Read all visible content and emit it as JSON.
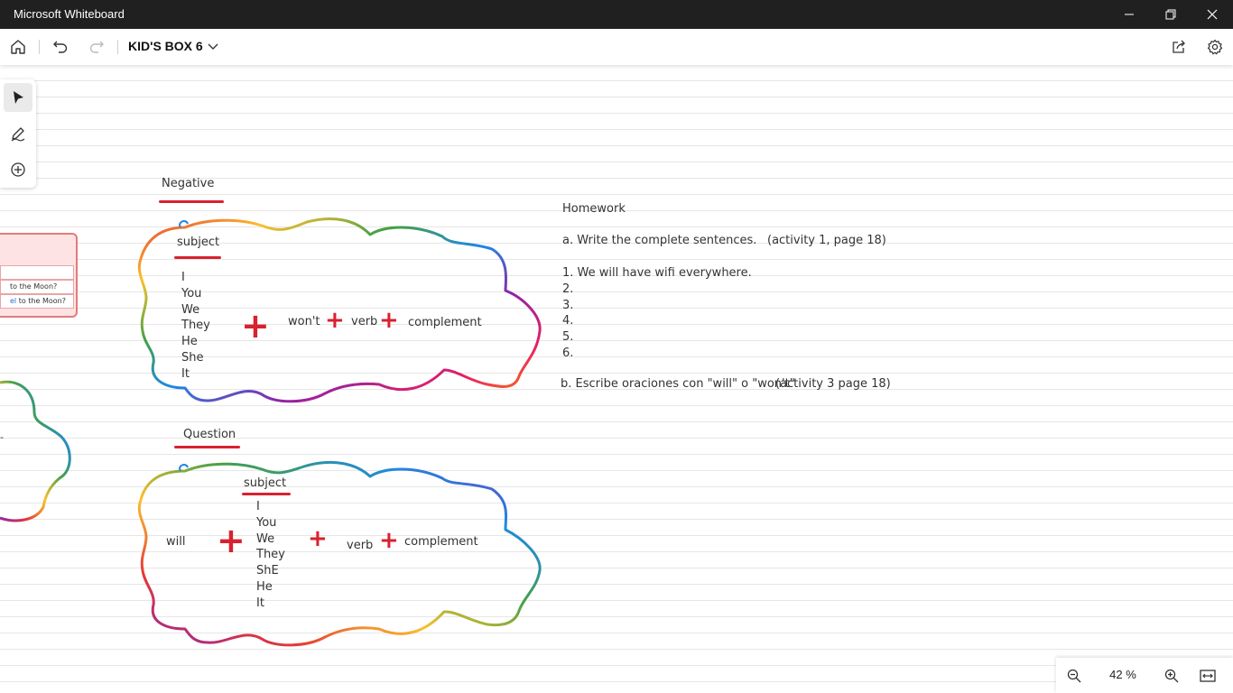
{
  "window": {
    "title": "Microsoft Whiteboard",
    "minimize_icon": "minimize-icon",
    "restore_icon": "restore-icon",
    "close_icon": "close-icon"
  },
  "toolbar": {
    "board_name": "KID'S BOX 6",
    "home_icon": "home-icon",
    "undo_icon": "undo-icon",
    "redo_icon": "redo-icon",
    "share_icon": "share-icon",
    "settings_icon": "gear-icon"
  },
  "left_panel": {
    "tools": [
      "select-arrow-icon",
      "pen-icon",
      "add-icon"
    ]
  },
  "zoom": {
    "level": "42 %"
  },
  "board": {
    "partial_card": {
      "line1": "to the Moon?",
      "line2_word": "el",
      "line2_rest": " to the Moon?"
    },
    "negative": {
      "heading": "Negative",
      "subject_label": "subject",
      "subjects": [
        "I",
        "You",
        "We",
        "They",
        "He",
        "She",
        "It"
      ],
      "wont": "won't",
      "verb": "verb",
      "complement": "complement"
    },
    "question": {
      "heading": "Question",
      "will": "will",
      "subject_label": "subject",
      "subjects": [
        "I",
        "You",
        "We",
        "They",
        "ShE",
        "He",
        "It"
      ],
      "verb": "verb",
      "complement": "complement"
    },
    "homework": {
      "heading": "Homework",
      "task_a": "a. Write the complete sentences.",
      "task_a_ref": "(activity 1, page 18)",
      "items": [
        "1. We will have wifi everywhere.",
        "2.",
        "3.",
        "4.",
        "5.",
        "6."
      ],
      "task_b": "b. Escribe oraciones con \"will\" o \"won't\"",
      "task_b_ref": "(activity 3 page 18)"
    },
    "colors": {
      "accent_red": "#d9212f",
      "title_bar": "#202020"
    }
  }
}
